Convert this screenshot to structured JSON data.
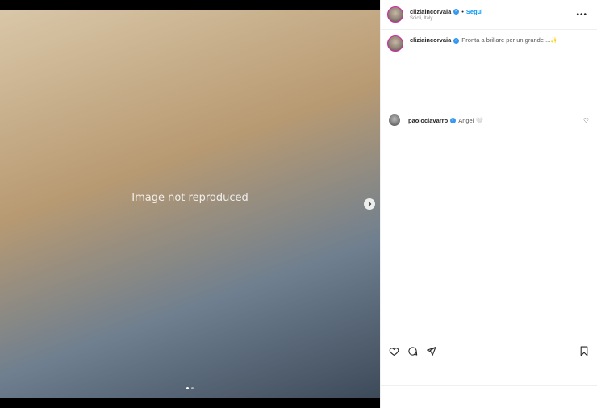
{
  "media": {
    "placeholder_note": "Image not reproduced",
    "slide_count": 2,
    "active_slide": 1
  },
  "header": {
    "username": "cliziaincorvaia",
    "separator": "•",
    "follow_label": "Segui",
    "location": "Scicli, Italy",
    "more_icon": "more-horizontal-icon"
  },
  "caption": {
    "username": "cliziaincorvaia",
    "text": "Pronta a brillare per un grande ...✨"
  },
  "comments": [
    {
      "username": "paolociavarro",
      "text": "Angel 🤍"
    }
  ],
  "actions": {
    "icons": [
      "heart-icon",
      "comment-icon",
      "share-icon",
      "bookmark-icon"
    ]
  },
  "colors": {
    "accent": "#0095f6",
    "verified": "#3897f0",
    "text": "#262626",
    "muted": "#8e8e8e",
    "border": "#efefef"
  }
}
